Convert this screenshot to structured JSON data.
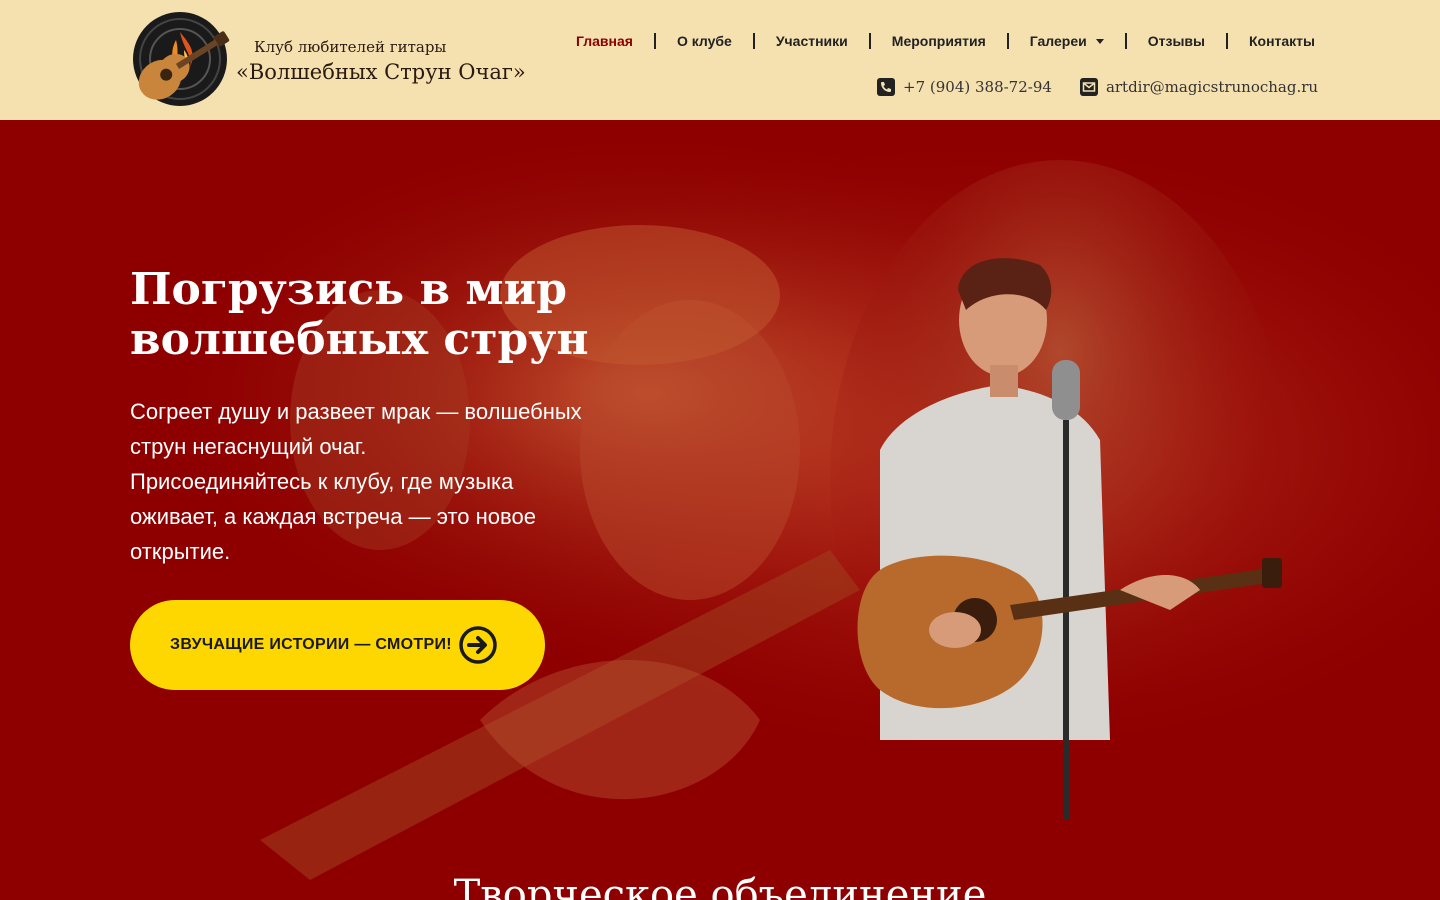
{
  "header": {
    "logo_line1": "Клуб любителей гитары",
    "logo_line2": "«Волшебных Струн Очаг»",
    "nav": [
      {
        "label": "Главная",
        "active": true
      },
      {
        "label": "О клубе"
      },
      {
        "label": "Участники"
      },
      {
        "label": "Мероприятия"
      },
      {
        "label": "Галереи",
        "dropdown": true
      },
      {
        "label": "Отзывы"
      },
      {
        "label": "Контакты"
      }
    ],
    "phone": "+7 (904) 388-72-94",
    "email": "artdir@magicstrunochag.ru"
  },
  "hero": {
    "title_line1": "Погрузись в мир",
    "title_line2": "волшебных струн",
    "text_line1": "Согреет душу и развеет мрак — волшебных",
    "text_line2": "струн негаснущий очаг.",
    "text_line3": "Присоединяйтесь к клубу, где музыка",
    "text_line4": "оживает, а каждая встреча — это новое",
    "text_line5": "открытие.",
    "button_label": "ЗВУЧАЩИЕ ИСТОРИИ — СМОТРИ!",
    "button_icon": "arrow-circle-right-icon"
  },
  "next_section": {
    "title": "Творческое объединение"
  },
  "colors": {
    "header_bg": "#f5e0b0",
    "hero_bg": "#8e0000",
    "active_nav": "#8b0000",
    "button_bg": "#ffd700"
  }
}
